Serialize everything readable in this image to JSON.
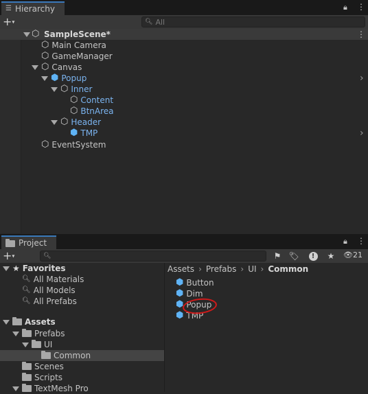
{
  "hierarchy": {
    "tab_label": "Hierarchy",
    "search_placeholder": "All",
    "scene": "SampleScene*",
    "items": [
      {
        "label": "Main Camera"
      },
      {
        "label": "GameManager"
      },
      {
        "label": "Canvas"
      },
      {
        "label": "Popup"
      },
      {
        "label": "Inner"
      },
      {
        "label": "Content"
      },
      {
        "label": "BtnArea"
      },
      {
        "label": "Header"
      },
      {
        "label": "TMP"
      },
      {
        "label": "EventSystem"
      }
    ]
  },
  "project": {
    "tab_label": "Project",
    "hidden_count": "21",
    "sidebar": {
      "favorites": "Favorites",
      "fav_items": [
        "All Materials",
        "All Models",
        "All Prefabs"
      ],
      "assets": "Assets",
      "prefabs": "Prefabs",
      "ui": "UI",
      "common": "Common",
      "scenes": "Scenes",
      "scripts": "Scripts",
      "textmesh": "TextMesh Pro"
    },
    "breadcrumb": [
      "Assets",
      "Prefabs",
      "UI",
      "Common"
    ],
    "assets_list": [
      "Button",
      "Dim",
      "Popup",
      "TMP"
    ]
  },
  "colors": {
    "prefab_text": "#7bb4f0",
    "annotation": "#d11a1a",
    "selection": "#444444"
  }
}
